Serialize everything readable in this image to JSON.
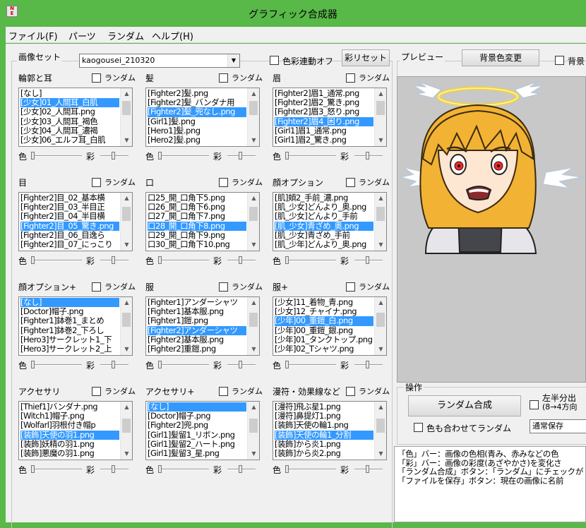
{
  "window": {
    "title": "グラフィック合成器",
    "icon": "app-icon"
  },
  "menu": [
    "ファイル(F)",
    "パーツ",
    "ランダム",
    "ヘルプ(H)"
  ],
  "imageset": {
    "label": "画像セット",
    "value": "kaogousei_210320",
    "color_link": "色彩連動オフ",
    "reset_button": "彩リセット"
  },
  "random_label": "ランダム",
  "slider_labels": {
    "hue": "色",
    "sat": "彩"
  },
  "parts": [
    {
      "title": "輪郭と耳",
      "items": [
        "[なし]",
        "[少女]01_人間耳_白肌",
        "[少女]02_人間耳.png",
        "[少女]03_人間耳_褐色",
        "[少女]04_人間耳_濃褐",
        "[少女]06_エルフ耳_白肌"
      ],
      "selected": 1
    },
    {
      "title": "髪",
      "items": [
        "[Fighter2]髪.png",
        "[Fighter2]髪_バンダナ用",
        "[Fighter2]髪_兜なし.png",
        "[Girl1]髪.png",
        "[Hero1]髪.png",
        "[Hero2]髪.png"
      ],
      "selected": 2
    },
    {
      "title": "眉",
      "items": [
        "[Fighter2]眉1_通常.png",
        "[Fighter2]眉2_驚き.png",
        "[Fighter2]眉3_怒り.png",
        "[Fighter2]眉4_困り.png",
        "[Girl1]眉1_通常.png",
        "[Girl1]眉2_驚き.png"
      ],
      "selected": 3
    },
    {
      "title": "目",
      "items": [
        "[Fighter2]目_02_基本横",
        "[Fighter2]目_03_半目正",
        "[Fighter2]目_04_半目横",
        "[Fighter2]目_05_驚き.png",
        "[Fighter2]目_06_目逸ら",
        "[Fighter2]目_07_にっこり"
      ],
      "selected": 3
    },
    {
      "title": "口",
      "items": [
        "口25_開_口角下5.png",
        "口26_開_口角下6.png",
        "口27_開_口角下7.png",
        "口28_開_口角下8.png",
        "口29_開_口角下9.png",
        "口30_開_口角下10.png"
      ],
      "selected": 3
    },
    {
      "title": "顔オプション",
      "items": [
        "[肌]頬2_手前_濃.png",
        "[肌_少女]どんより_奥.png",
        "[肌_少女]どんより_手前",
        "[肌_少女]青ざめ_奥.png",
        "[肌_少女]青ざめ_手前",
        "[肌_少年]どんより_奥.png"
      ],
      "selected": 3
    },
    {
      "title": "顔オプション+",
      "items": [
        "[なし]",
        "[Doctor]帽子.png",
        "[Fighter1]鉢巻1_まとめ",
        "[Fighter1]鉢巻2_下ろし",
        "[Hero3]サークレット1_下",
        "[Hero3]サークレット2_上"
      ],
      "selected": 0
    },
    {
      "title": "服",
      "items": [
        "[Fighter1]アンダーシャツ",
        "[Fighter1]基本服.png",
        "[Fighter1]鎧.png",
        "[Fighter2]アンダーシャツ",
        "[Fighter2]基本服.png",
        "[Fighter2]重鎧.png"
      ],
      "selected": 3
    },
    {
      "title": "服+",
      "items": [
        "[少女]11_着物_青.png",
        "[少女]12_チャイナ.png",
        "[少年]00_重鎧_白.png",
        "[少年]00_重鎧_銀.png",
        "[少年]01_タンクトップ.png",
        "[少年]02_Tシャツ.png"
      ],
      "selected": 2
    },
    {
      "title": "アクセサリ",
      "items": [
        "[Thief1]バンダナ.png",
        "[Witch1]帽子.png",
        "[Wolfarl]羽根付き帽p",
        "[装飾]天使の羽1.png",
        "[装飾]妖精の羽1.png",
        "[装飾]悪魔の羽1.png"
      ],
      "selected": 3
    },
    {
      "title": "アクセサリ+",
      "items": [
        "[なし]",
        "[Doctor]帽子.png",
        "[Fighter2]兜.png",
        "[Girl1]髪留1_リボン.png",
        "[Girl1]髪留2_ハート.png",
        "[Girl1]髪留3_星.png"
      ],
      "selected": 0
    },
    {
      "title": "漫符・効果線など",
      "items": [
        "[漫符]飛ぶ星1.png",
        "[漫符]鼻提灯1.png",
        "[装飾]天使の輪1.png",
        "[装飾]天使の輪1_分割",
        "[装飾]から炎1.png",
        "[装飾]から炎2.png"
      ],
      "selected": 3
    }
  ],
  "preview": {
    "label": "プレビュー",
    "bgcolor_button": "背景色変更",
    "bg_check": "背景"
  },
  "ops": {
    "label": "操作",
    "random_button": "ランダム合成",
    "split_check_line1": "左半分出",
    "split_check_line2": "(8→4方向",
    "color_random_check": "色も合わせてランダム",
    "save_mode": "通常保存"
  },
  "description": [
    "「色」バー：画像の色相(青み、赤みなどの色",
    "「彩」バー：画像の彩度(あざやかさ)を変化さ",
    "",
    "「ランダム合成」ボタン：「ランダム」にチェックが",
    "「ファイルを保存」ボタン：現在の画像に名前"
  ],
  "colors": {
    "titlebar": "#58b848",
    "selection": "#3399ff",
    "preview_bg": "#c8c8c8"
  }
}
